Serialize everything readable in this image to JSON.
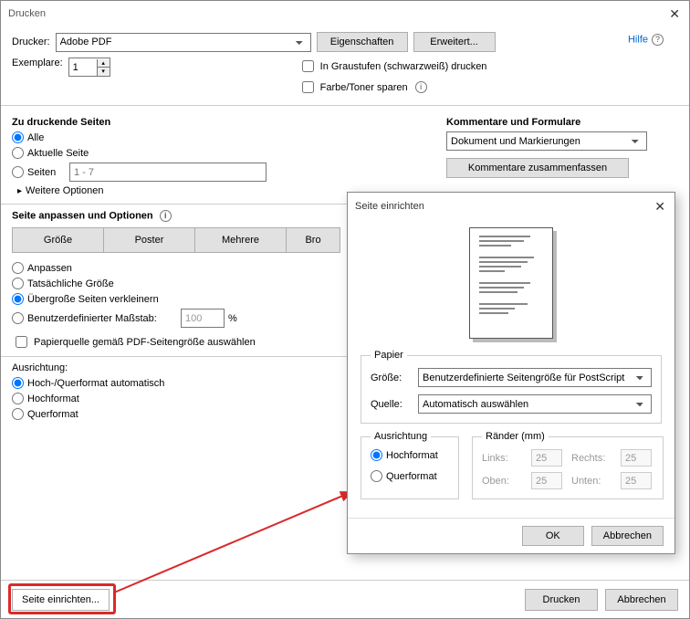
{
  "main": {
    "title": "Drucken",
    "printerLabel": "Drucker:",
    "printerValue": "Adobe PDF",
    "propertiesBtn": "Eigenschaften",
    "advancedBtn": "Erweitert...",
    "helpLink": "Hilfe",
    "copiesLabel": "Exemplare:",
    "copiesValue": "1",
    "grayscaleLabel": "In Graustufen (schwarzweiß) drucken",
    "saveTonerLabel": "Farbe/Toner sparen",
    "pagesHeading": "Zu druckende Seiten",
    "allLabel": "Alle",
    "currentLabel": "Aktuelle Seite",
    "rangeLabel": "Seiten",
    "rangePlaceholder": "1 - 7",
    "moreOptions": "Weitere Optionen",
    "fitHeading": "Seite anpassen und Optionen",
    "sizeBtn": "Größe",
    "posterBtn": "Poster",
    "multipleBtn": "Mehrere",
    "bookletBtn": "Bro",
    "fitOpt": "Anpassen",
    "actualOpt": "Tatsächliche Größe",
    "shrinkOpt": "Übergroße Seiten verkleinern",
    "customOpt": "Benutzerdefinierter Maßstab:",
    "customValue": "100",
    "percent": "%",
    "sourceLabel": "Papierquelle gemäß PDF-Seitengröße auswählen",
    "orientHeading": "Ausrichtung:",
    "autoOrient": "Hoch-/Querformat automatisch",
    "portrait": "Hochformat",
    "landscape": "Querformat",
    "commentsHeading": "Kommentare und Formulare",
    "commentsValue": "Dokument und Markierungen",
    "summarizeBtn": "Kommentare zusammenfassen",
    "pageSetupBtn": "Seite einrichten...",
    "printBtn": "Drucken",
    "cancelBtn": "Abbrechen"
  },
  "dialog": {
    "title": "Seite einrichten",
    "paperLegend": "Papier",
    "sizeLabel": "Größe:",
    "sizeValue": "Benutzerdefinierte Seitengröße für PostScript",
    "sourceLabel": "Quelle:",
    "sourceValue": "Automatisch auswählen",
    "orientLegend": "Ausrichtung",
    "portraitLabel": "Hochformat",
    "landscapeLabel": "Querformat",
    "marginsLegend": "Ränder (mm)",
    "leftLabel": "Links:",
    "rightLabel": "Rechts:",
    "topLabel": "Oben:",
    "bottomLabel": "Unten:",
    "marginValue": "25",
    "okBtn": "OK",
    "cancelBtn": "Abbrechen"
  }
}
